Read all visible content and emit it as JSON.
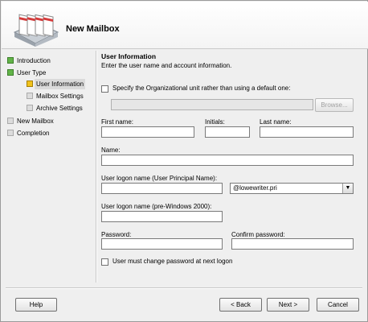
{
  "window": {
    "title": "New Mailbox"
  },
  "nav": {
    "items": [
      {
        "label": "Introduction",
        "state": "complete"
      },
      {
        "label": "User Type",
        "state": "complete"
      },
      {
        "label": "User Information",
        "state": "current"
      },
      {
        "label": "Mailbox Settings",
        "state": "pending"
      },
      {
        "label": "Archive Settings",
        "state": "pending"
      },
      {
        "label": "New Mailbox",
        "state": "pending"
      },
      {
        "label": "Completion",
        "state": "pending"
      }
    ]
  },
  "section": {
    "title": "User Information",
    "description": "Enter the user name and account information."
  },
  "form": {
    "ou_checkbox_label": "Specify the Organizational unit rather than using a default one:",
    "ou_value": "",
    "browse_label": "Browse...",
    "first_name_label": "First name:",
    "first_name_value": "",
    "initials_label": "Initials:",
    "initials_value": "",
    "last_name_label": "Last name:",
    "last_name_value": "",
    "name_label": "Name:",
    "name_value": "",
    "upn_label": "User logon name (User Principal Name):",
    "upn_value": "",
    "domain_value": "@lowewriter.pri",
    "pre2000_label": "User logon name (pre-Windows 2000):",
    "pre2000_value": "",
    "password_label": "Password:",
    "password_value": "",
    "confirm_label": "Confirm password:",
    "confirm_value": "",
    "must_change_label": "User must change password at next logon"
  },
  "buttons": {
    "help": "Help",
    "back": "< Back",
    "next": "Next >",
    "cancel": "Cancel"
  },
  "colors": {
    "complete": "#62b448",
    "current": "#f1c21b",
    "pending": "#dcdcdc"
  }
}
